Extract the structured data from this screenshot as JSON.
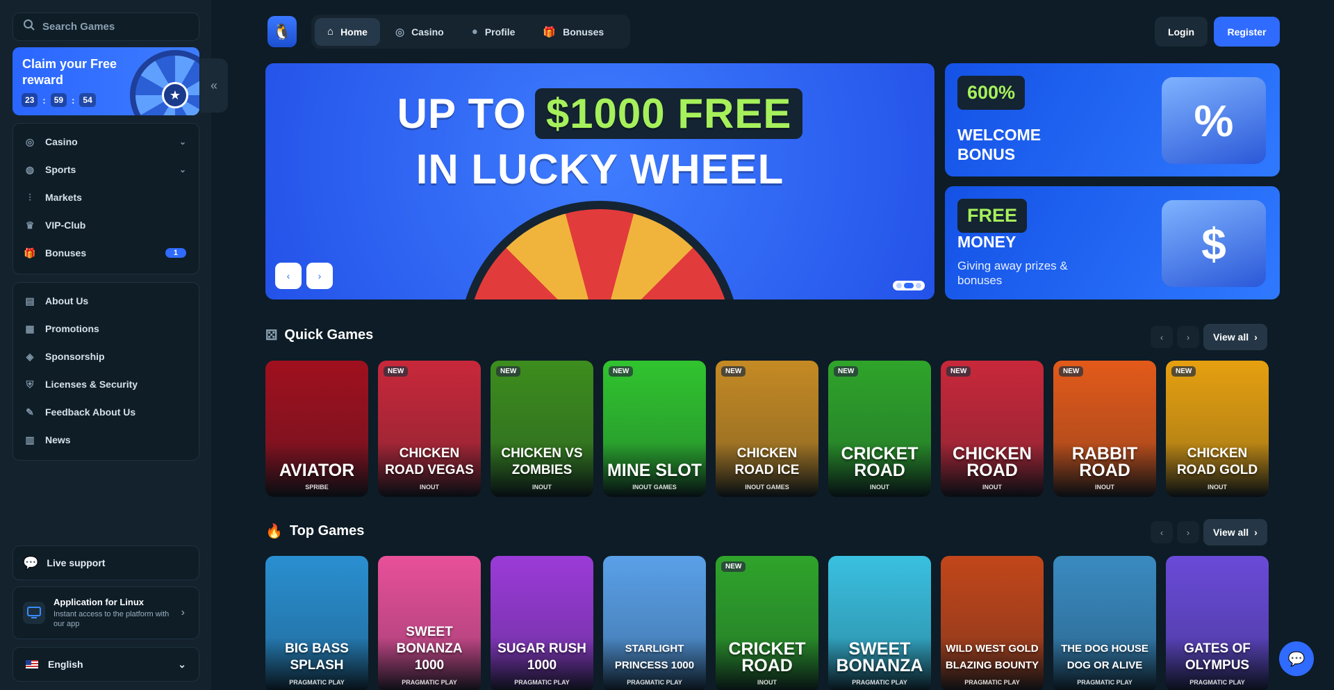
{
  "sidebar": {
    "search_placeholder": "Search Games",
    "reward": {
      "title": "Claim your Free reward",
      "hours": "23",
      "minutes": "59",
      "seconds": "54",
      "sep": ":"
    },
    "nav1": [
      {
        "label": "Casino",
        "icon": "casino-icon",
        "chevron": true
      },
      {
        "label": "Sports",
        "icon": "globe-icon",
        "chevron": true
      },
      {
        "label": "Markets",
        "icon": "markets-icon"
      },
      {
        "label": "VIP-Club",
        "icon": "crown-icon"
      },
      {
        "label": "Bonuses",
        "icon": "gift-icon",
        "badge": "1"
      }
    ],
    "nav2": [
      {
        "label": "About Us",
        "icon": "book-icon"
      },
      {
        "label": "Promotions",
        "icon": "ticket-icon"
      },
      {
        "label": "Sponsorship",
        "icon": "sponsor-icon"
      },
      {
        "label": "Licenses & Security",
        "icon": "shield-icon"
      },
      {
        "label": "Feedback About Us",
        "icon": "feedback-icon"
      },
      {
        "label": "News",
        "icon": "news-icon"
      }
    ],
    "support_label": "Live support",
    "app": {
      "title": "Application for Linux",
      "subtitle": "Instant access to the platform with our app"
    },
    "language": "English"
  },
  "header": {
    "tabs": [
      {
        "label": "Home",
        "icon": "home-icon",
        "active": true
      },
      {
        "label": "Casino",
        "icon": "casino-icon"
      },
      {
        "label": "Profile",
        "icon": "user-icon"
      },
      {
        "label": "Bonuses",
        "icon": "gift-icon"
      }
    ],
    "login_label": "Login",
    "register_label": "Register"
  },
  "hero": {
    "prefix": "UP TO",
    "amount": "$1000 FREE",
    "line2": "IN LUCKY WHEEL",
    "prev": "‹",
    "next": "›",
    "slide_count": 3,
    "active_slide": 2
  },
  "promos": [
    {
      "tag": "600%",
      "headline": "WELCOME BONUS",
      "sub": "",
      "art": "%"
    },
    {
      "tag": "FREE",
      "headline": "MONEY",
      "sub": "Giving away prizes & bonuses",
      "art": "$"
    }
  ],
  "sections": {
    "quick": {
      "title": "Quick Games",
      "view_all": "View all",
      "games": [
        {
          "name": "AVIATOR",
          "provider": "SPRIBE",
          "new": false,
          "color": "#a0101e"
        },
        {
          "name": "CHICKEN ROAD VEGAS",
          "provider": "INOUT",
          "new": true,
          "color": "#c8283a"
        },
        {
          "name": "CHICKEN VS ZOMBIES",
          "provider": "INOUT",
          "new": true,
          "color": "#3d8d1e"
        },
        {
          "name": "MINE SLOT",
          "provider": "INOUT GAMES",
          "new": true,
          "color": "#31c42f"
        },
        {
          "name": "CHICKEN ROAD ICE",
          "provider": "INOUT GAMES",
          "new": true,
          "color": "#c58a24"
        },
        {
          "name": "CRICKET ROAD",
          "provider": "INOUT",
          "new": true,
          "color": "#2fa42a"
        },
        {
          "name": "CHICKEN ROAD",
          "provider": "INOUT",
          "new": true,
          "color": "#c8283a"
        },
        {
          "name": "RABBIT ROAD",
          "provider": "INOUT",
          "new": true,
          "color": "#e35a1a"
        },
        {
          "name": "CHICKEN ROAD GOLD",
          "provider": "INOUT",
          "new": true,
          "color": "#e6a010"
        }
      ],
      "new_label": "NEW"
    },
    "top": {
      "title": "Top Games",
      "view_all": "View all",
      "games": [
        {
          "name": "BIG BASS SPLASH",
          "provider": "PRAGMATIC PLAY",
          "new": false,
          "color": "#2a8fd0"
        },
        {
          "name": "SWEET BONANZA 1000",
          "provider": "PRAGMATIC PLAY",
          "new": false,
          "color": "#e8509a"
        },
        {
          "name": "SUGAR RUSH 1000",
          "provider": "PRAGMATIC PLAY",
          "new": false,
          "color": "#9b3bd8"
        },
        {
          "name": "STARLIGHT PRINCESS 1000",
          "provider": "PRAGMATIC PLAY",
          "new": false,
          "color": "#5aa0e8"
        },
        {
          "name": "CRICKET ROAD",
          "provider": "INOUT",
          "new": true,
          "color": "#2fa42a"
        },
        {
          "name": "SWEET BONANZA",
          "provider": "PRAGMATIC PLAY",
          "new": false,
          "color": "#3ac0e0"
        },
        {
          "name": "WILD WEST GOLD BLAZING BOUNTY",
          "provider": "PRAGMATIC PLAY",
          "new": false,
          "color": "#c2461a"
        },
        {
          "name": "THE DOG HOUSE DOG OR ALIVE",
          "provider": "PRAGMATIC PLAY",
          "new": false,
          "color": "#3a8ac0"
        },
        {
          "name": "GATES OF OLYMPUS",
          "provider": "PRAGMATIC PLAY",
          "new": false,
          "color": "#6a4ad8"
        }
      ],
      "new_label": "NEW"
    }
  },
  "colors": {
    "accent": "#2f6bff",
    "green": "#a6f05b",
    "bg": "#0d1c26"
  }
}
